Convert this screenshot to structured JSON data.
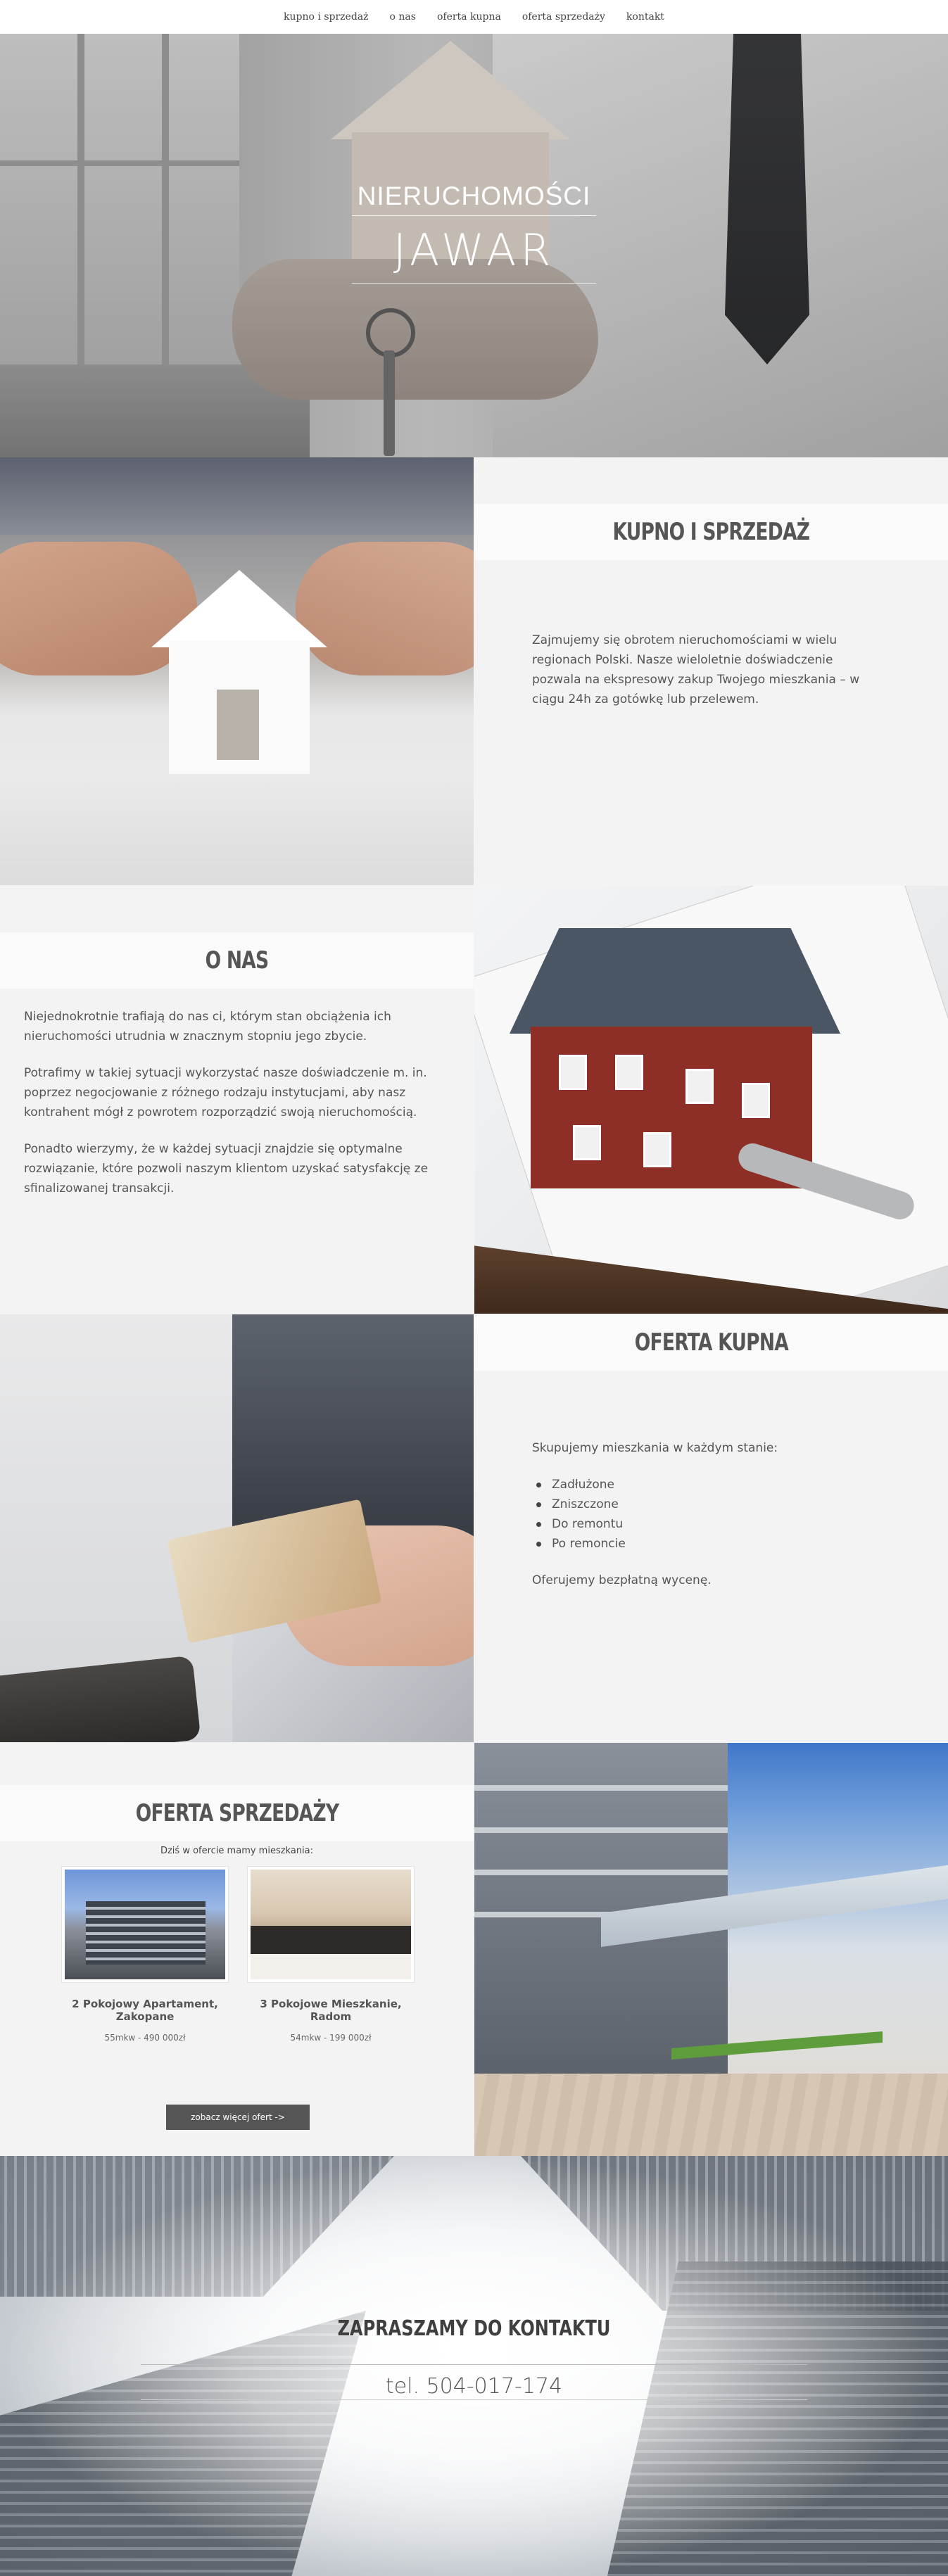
{
  "nav": {
    "items": [
      "kupno i sprzedaż",
      "o nas",
      "oferta kupna",
      "oferta sprzedaży",
      "kontakt"
    ]
  },
  "hero": {
    "title": "NIERUCHOMOŚCI",
    "subtitle": "JAWAR"
  },
  "kupno": {
    "heading": "KUPNO I SPRZEDAŻ",
    "text": "Zajmujemy się obrotem nieruchomościami w wielu regionach Polski. Nasze wieloletnie doświadczenie pozwala na ekspresowy zakup Twojego mieszkania – w ciągu 24h za gotówkę lub przelewem."
  },
  "onas": {
    "heading": "O NAS",
    "paragraphs": [
      "Niejednokrotnie trafiają do nas ci, którym stan obciążenia ich nieruchomości utrudnia w znacznym stopniu jego zbycie.",
      "Potrafimy w takiej sytuacji wykorzystać nasze doświadczenie m. in. poprzez negocjowanie z różnego rodzaju instytucjami, aby nasz kontrahent mógł z powrotem rozporządzić swoją nieruchomością.",
      "Ponadto wierzymy, że w każdej sytuacji znajdzie się optymalne rozwiązanie, które pozwoli naszym klientom uzyskać satysfakcję ze sfinalizowanej transakcji."
    ]
  },
  "kupna": {
    "heading": "OFERTA KUPNA",
    "intro": "Skupujemy mieszkania w każdym stanie:",
    "items": [
      "Zadłużone",
      "Zniszczone",
      "Do remontu",
      "Po remoncie"
    ],
    "outro": "Oferujemy bezpłatną wycenę."
  },
  "sprzedazy": {
    "heading": "OFERTA SPRZEDAŻY",
    "sub": "Dziś w ofercie mamy mieszkania:",
    "cards": [
      {
        "name": "2 Pokojowy Apartament, Zakopane",
        "price": "55mkw - 490 000zł"
      },
      {
        "name": "3 Pokojowe Mieszkanie, Radom",
        "price": "54mkw - 199 000zł"
      }
    ],
    "button": "zobacz więcej ofert ->"
  },
  "contact": {
    "heading": "ZAPRASZAMY DO KONTAKTU",
    "phone": "tel. 504-017-174"
  }
}
